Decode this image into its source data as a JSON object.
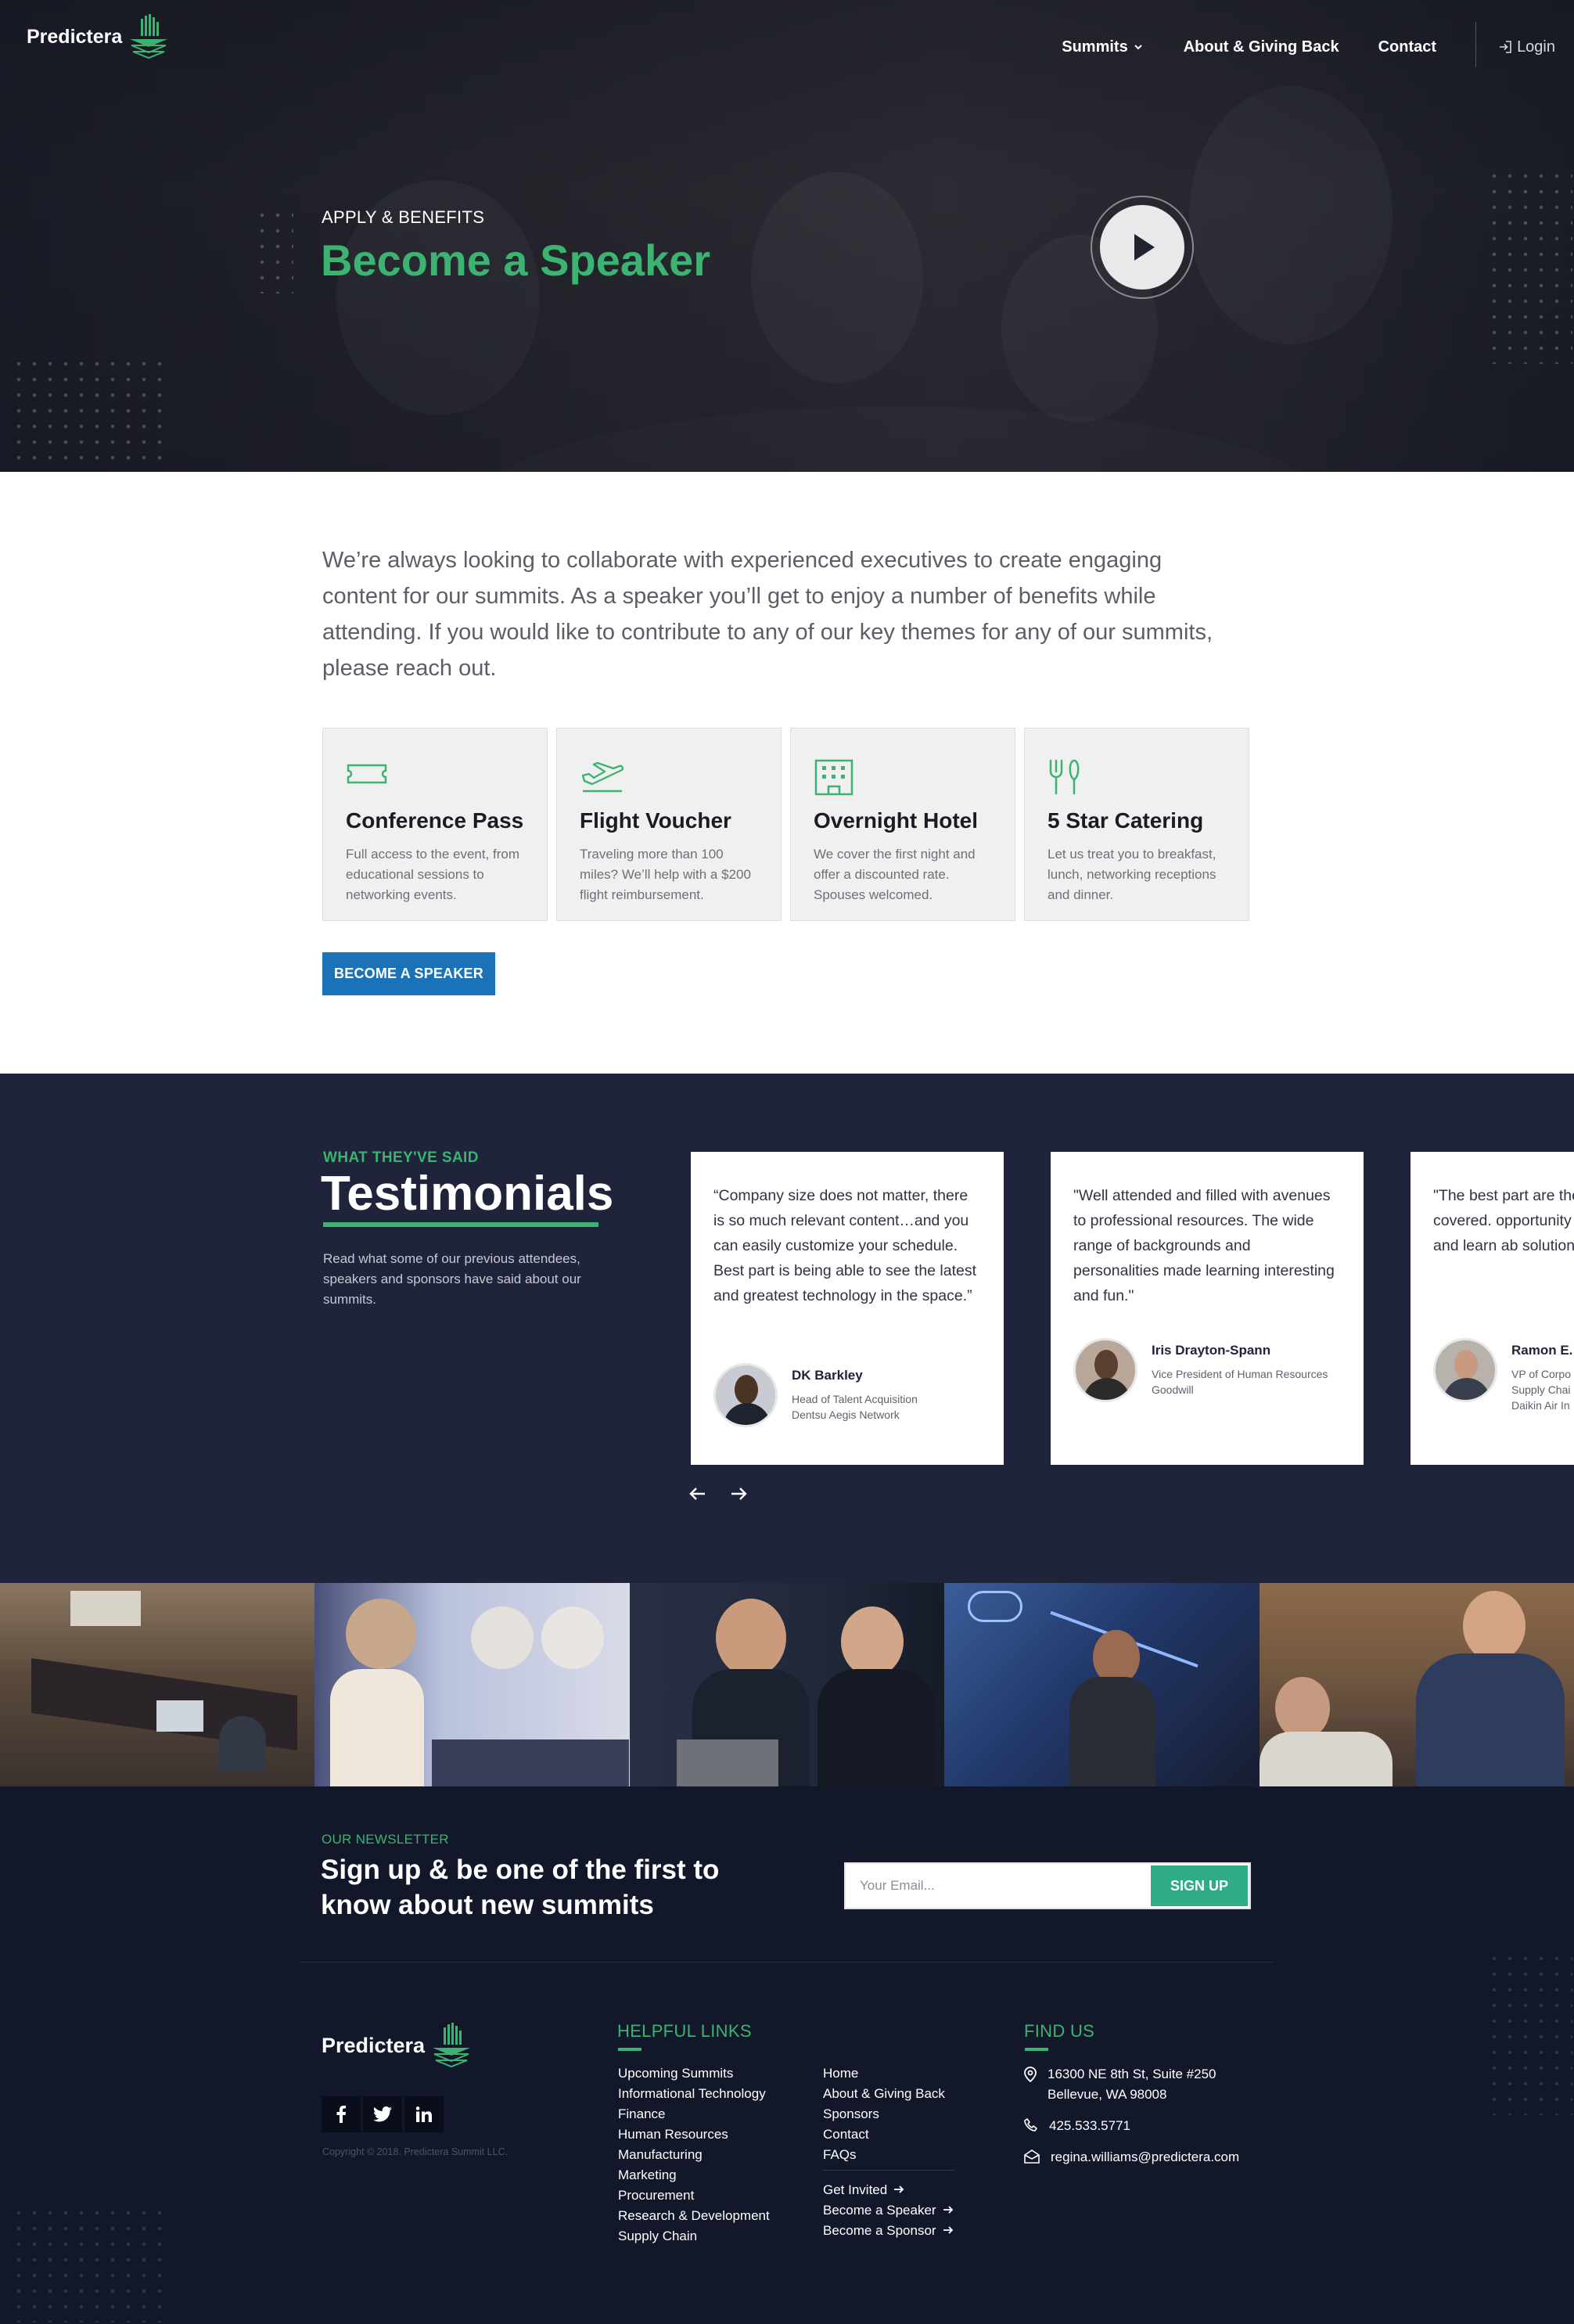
{
  "brand": {
    "name": "Predictera"
  },
  "nav": {
    "items": [
      {
        "label": "Summits",
        "has_dropdown": true
      },
      {
        "label": "About & Giving Back"
      },
      {
        "label": "Contact"
      }
    ],
    "login": {
      "label": "Login",
      "icon": "login-icon"
    }
  },
  "hero": {
    "kicker": "APPLY & BENEFITS",
    "title": "Become a Speaker",
    "play_icon": "play-icon"
  },
  "intro": {
    "text": "We’re always looking to collaborate with experienced executives to create engaging content for our summits. As a speaker you’ll get to enjoy a number of benefits while attending. If you would like to contribute to any of our key themes for any of our summits, please reach out."
  },
  "benefits": [
    {
      "icon": "ticket-icon",
      "title": "Conference Pass",
      "text": "Full access to the event, from educational sessions to networking events."
    },
    {
      "icon": "airplane-icon",
      "title": "Flight Voucher",
      "text": "Traveling more than 100 miles? We’ll help with a $200 flight reimbursement."
    },
    {
      "icon": "hotel-icon",
      "title": "Overnight Hotel",
      "text": "We cover the first night and offer a discounted rate. Spouses welcomed."
    },
    {
      "icon": "utensils-icon",
      "title": "5 Star Catering",
      "text": "Let us treat you to breakfast, lunch, networking receptions and dinner."
    }
  ],
  "cta": {
    "label": "BECOME A SPEAKER"
  },
  "testimonials": {
    "kicker": "WHAT THEY'VE SAID",
    "title": "Testimonials",
    "description": "Read what some of our previous attendees, speakers and sponsors have said about our summits.",
    "items": [
      {
        "quote": "“Company size does not matter, there is so much relevant content…and you can easily customize your schedule. Best part is being able to see the latest and greatest technology in the space.”",
        "name": "DK Barkley",
        "role_lines": [
          "Head of Talent Acquisition",
          "Dentsu Aegis Network"
        ]
      },
      {
        "quote": "\"Well attended and filled with avenues to professional resources. The wide range of backgrounds and personalities made learning interesting and fun.\"",
        "name": "Iris Drayton-Spann",
        "role_lines": [
          "Vice President of Human Resources",
          "Goodwill"
        ]
      },
      {
        "quote": "\"The best part are the and topics covered. opportunity to hear f network and learn ab solutions in the field",
        "name": "Ramon E.",
        "role_lines": [
          "VP of Corpo",
          "Supply Chai",
          "Daikin Air In"
        ]
      }
    ],
    "prev_icon": "arrow-left-icon",
    "next_icon": "arrow-right-icon"
  },
  "newsletter": {
    "kicker": "OUR NEWSLETTER",
    "title": "Sign up & be one of the first to know about new summits",
    "placeholder": "Your Email...",
    "button": "SIGN UP"
  },
  "footer": {
    "socials": [
      "facebook-icon",
      "twitter-icon",
      "linkedin-icon"
    ],
    "copyright": "Copyright © 2018. Predictera Summit LLC.",
    "links_heading": "HELPFUL LINKS",
    "links_col1": [
      "Upcoming Summits",
      "Informational Technology",
      "Finance",
      "Human Resources",
      "Manufacturing",
      "Marketing",
      "Procurement",
      "Research & Development",
      "Supply Chain"
    ],
    "links_col2": [
      "Home",
      "About & Giving Back",
      "Sponsors",
      "Contact",
      "FAQs"
    ],
    "links_col2_actions": [
      "Get Invited",
      "Become a Speaker",
      "Become a Sponsor"
    ],
    "find_heading": "FIND US",
    "address_line1": "16300 NE 8th St, Suite #250",
    "address_line2": "Bellevue, WA 98008",
    "phone": "425.533.5771",
    "email": "regina.williams@predictera.com"
  },
  "colors": {
    "accent": "#3cb371",
    "cta": "#1a73b8",
    "signup": "#2eac85",
    "dark": "#20243a",
    "footer": "#121829"
  }
}
